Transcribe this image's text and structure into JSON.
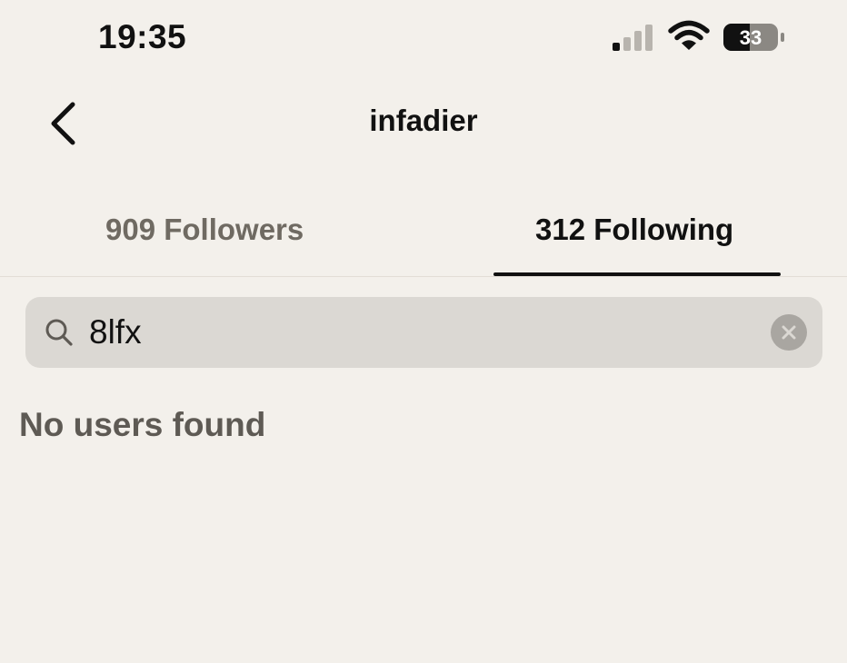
{
  "status_bar": {
    "time": "19:35",
    "battery_level": "33",
    "signal_bars_active": 1,
    "signal_bars_total": 4
  },
  "header": {
    "title": "infadier",
    "back_icon": "chevron-left-icon"
  },
  "tabs": [
    {
      "label": "909 Followers",
      "selected": false
    },
    {
      "label": "312 Following",
      "selected": true
    }
  ],
  "search": {
    "value": "8lfx",
    "search_icon": "search-icon",
    "clear_icon": "clear-icon"
  },
  "results": {
    "empty_message": "No users found"
  },
  "colors": {
    "background": "#f3f0eb",
    "search_bg": "#dbd8d3",
    "text_primary": "#111111",
    "text_secondary": "#6f6a62",
    "empty_text": "#5e5a54"
  }
}
